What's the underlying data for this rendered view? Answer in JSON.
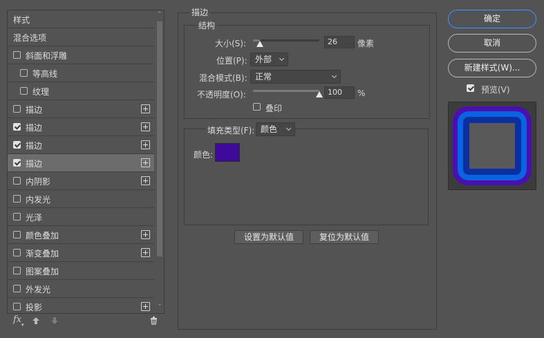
{
  "left_panel": {
    "rows": [
      {
        "label": "样式",
        "checkbox": null,
        "checked": false,
        "plus": false,
        "indent": 0,
        "selected": false
      },
      {
        "label": "混合选项",
        "checkbox": null,
        "checked": false,
        "plus": false,
        "indent": 0,
        "selected": false
      },
      {
        "label": "斜面和浮雕",
        "checkbox": true,
        "checked": false,
        "plus": false,
        "indent": 0,
        "selected": false
      },
      {
        "label": "等高线",
        "checkbox": true,
        "checked": false,
        "plus": false,
        "indent": 1,
        "selected": false
      },
      {
        "label": "纹理",
        "checkbox": true,
        "checked": false,
        "plus": false,
        "indent": 1,
        "selected": false
      },
      {
        "label": "描边",
        "checkbox": true,
        "checked": false,
        "plus": true,
        "indent": 0,
        "selected": false
      },
      {
        "label": "描边",
        "checkbox": true,
        "checked": true,
        "plus": true,
        "indent": 0,
        "selected": false
      },
      {
        "label": "描边",
        "checkbox": true,
        "checked": true,
        "plus": true,
        "indent": 0,
        "selected": false
      },
      {
        "label": "描边",
        "checkbox": true,
        "checked": true,
        "plus": true,
        "indent": 0,
        "selected": true
      },
      {
        "label": "内阴影",
        "checkbox": true,
        "checked": false,
        "plus": true,
        "indent": 0,
        "selected": false
      },
      {
        "label": "内发光",
        "checkbox": true,
        "checked": false,
        "plus": false,
        "indent": 0,
        "selected": false
      },
      {
        "label": "光泽",
        "checkbox": true,
        "checked": false,
        "plus": false,
        "indent": 0,
        "selected": false
      },
      {
        "label": "颜色叠加",
        "checkbox": true,
        "checked": false,
        "plus": true,
        "indent": 0,
        "selected": false
      },
      {
        "label": "渐变叠加",
        "checkbox": true,
        "checked": false,
        "plus": true,
        "indent": 0,
        "selected": false
      },
      {
        "label": "图案叠加",
        "checkbox": true,
        "checked": false,
        "plus": false,
        "indent": 0,
        "selected": false
      },
      {
        "label": "外发光",
        "checkbox": true,
        "checked": false,
        "plus": false,
        "indent": 0,
        "selected": false
      },
      {
        "label": "投影",
        "checkbox": true,
        "checked": false,
        "plus": true,
        "indent": 0,
        "selected": false
      }
    ],
    "toolbar": {
      "fx_label": "fx",
      "up_icon": "arrow-up-icon",
      "down_icon": "arrow-down-icon",
      "trash_icon": "trash-icon"
    }
  },
  "stroke": {
    "section_title": "描边",
    "structure_title": "结构",
    "size_label": "大小(S):",
    "size_value": "26",
    "size_unit": "像素",
    "size_slider_fraction": 0.1,
    "position_label": "位置(P):",
    "position_value": "外部",
    "blend_label": "混合模式(B):",
    "blend_value": "正常",
    "opacity_label": "不透明度(O):",
    "opacity_value": "100",
    "opacity_unit": "%",
    "opacity_slider_fraction": 1.0,
    "overprint_label": "叠印",
    "overprint_checked": false,
    "fill_type_label": "填充类型(F):",
    "fill_type_value": "颜色",
    "color_label": "颜色:",
    "color_swatch": "#3d0a99",
    "set_default_label": "设置为默认值",
    "reset_default_label": "复位为默认值"
  },
  "right_panel": {
    "ok_label": "确定",
    "cancel_label": "取消",
    "new_style_label": "新建样式(W)...",
    "preview_label": "预览(V)",
    "preview_checked": true,
    "preview_colors": {
      "outer": "#4a0fb0",
      "middle": "#0a63e0",
      "inner_ring": "#0a2fa0",
      "center": "#595959"
    }
  }
}
